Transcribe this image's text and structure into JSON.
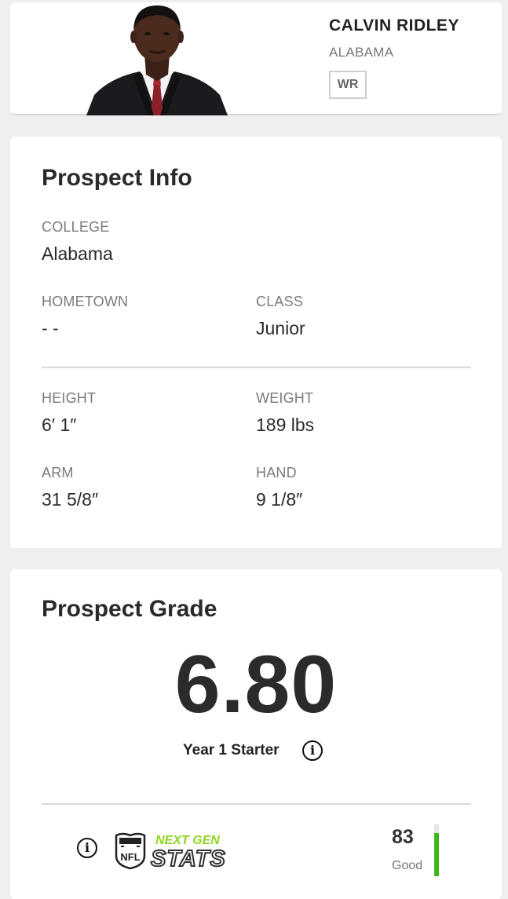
{
  "player": {
    "name": "CALVIN RIDLEY",
    "school": "ALABAMA",
    "position": "WR"
  },
  "prospect_info": {
    "title": "Prospect Info",
    "college": {
      "label": "COLLEGE",
      "value": "Alabama"
    },
    "hometown": {
      "label": "HOMETOWN",
      "value": "- -"
    },
    "class": {
      "label": "CLASS",
      "value": "Junior"
    },
    "height": {
      "label": "HEIGHT",
      "value": "6′ 1″"
    },
    "weight": {
      "label": "WEIGHT",
      "value": "189 lbs"
    },
    "arm": {
      "label": "ARM",
      "value": "31 5/8″"
    },
    "hand": {
      "label": "HAND",
      "value": "9 1/8″"
    }
  },
  "prospect_grade": {
    "title": "Prospect Grade",
    "grade": "6.80",
    "description": "Year 1 Starter",
    "next_gen_stats": {
      "logo_text_top": "NEXT GEN",
      "logo_text_bottom": "STATS",
      "score": "83",
      "rating": "Good",
      "score_fraction": 0.83
    }
  },
  "colors": {
    "background": "#efefef",
    "card": "#ffffff",
    "ngs_green": "#3fb61b",
    "ngs_green_light": "#8fd51f",
    "text_dark": "#222222",
    "text_muted": "#7a7a7a"
  }
}
